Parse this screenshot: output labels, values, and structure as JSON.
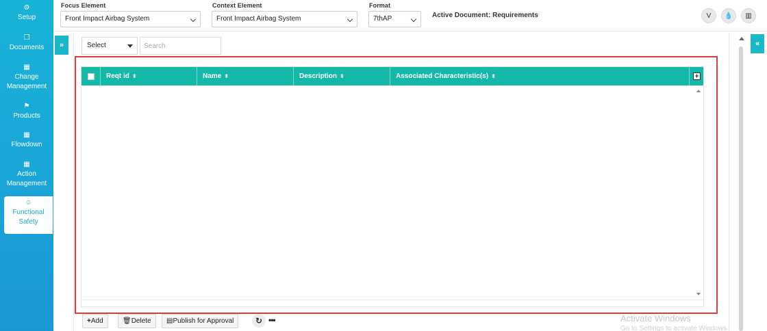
{
  "sidebar": {
    "items": [
      {
        "label": "Setup",
        "icon": "gears-icon"
      },
      {
        "label": "Documents",
        "icon": "copy-icon"
      },
      {
        "label": "Change Management",
        "icon": "building-icon"
      },
      {
        "label": "Products",
        "icon": "flag-icon"
      },
      {
        "label": "Flowdown",
        "icon": "building-icon"
      },
      {
        "label": "Action Management",
        "icon": "building-icon"
      },
      {
        "label": "Functional Safety",
        "icon": "smile-icon",
        "active": true
      }
    ]
  },
  "header": {
    "focus_label": "Focus Element",
    "focus_value": "Front Impact Airbag System",
    "context_label": "Context Element",
    "context_value": "Front Impact Airbag System",
    "format_label": "Format",
    "format_value": "7thAP",
    "active_doc_label": "Active Document",
    "active_doc_value": ": Requirements",
    "icons": [
      "vine-icon",
      "drop-icon",
      "chart-icon"
    ]
  },
  "filter": {
    "select_value": "Select",
    "search_placeholder": "Search"
  },
  "table": {
    "columns": [
      "Reqt id",
      "Name",
      "Description",
      "Associated Characteristic(s)"
    ],
    "rows": []
  },
  "actions": {
    "add": "Add",
    "delete": "Delete",
    "publish": "Publish for Approval"
  },
  "watermark": {
    "line1": "Activate Windows",
    "line2": "Go to Settings to activate Windows."
  },
  "colors": {
    "sidebar": "#1aa6d8",
    "table_header": "#13b8a8",
    "highlight_border": "#e23a3a"
  }
}
